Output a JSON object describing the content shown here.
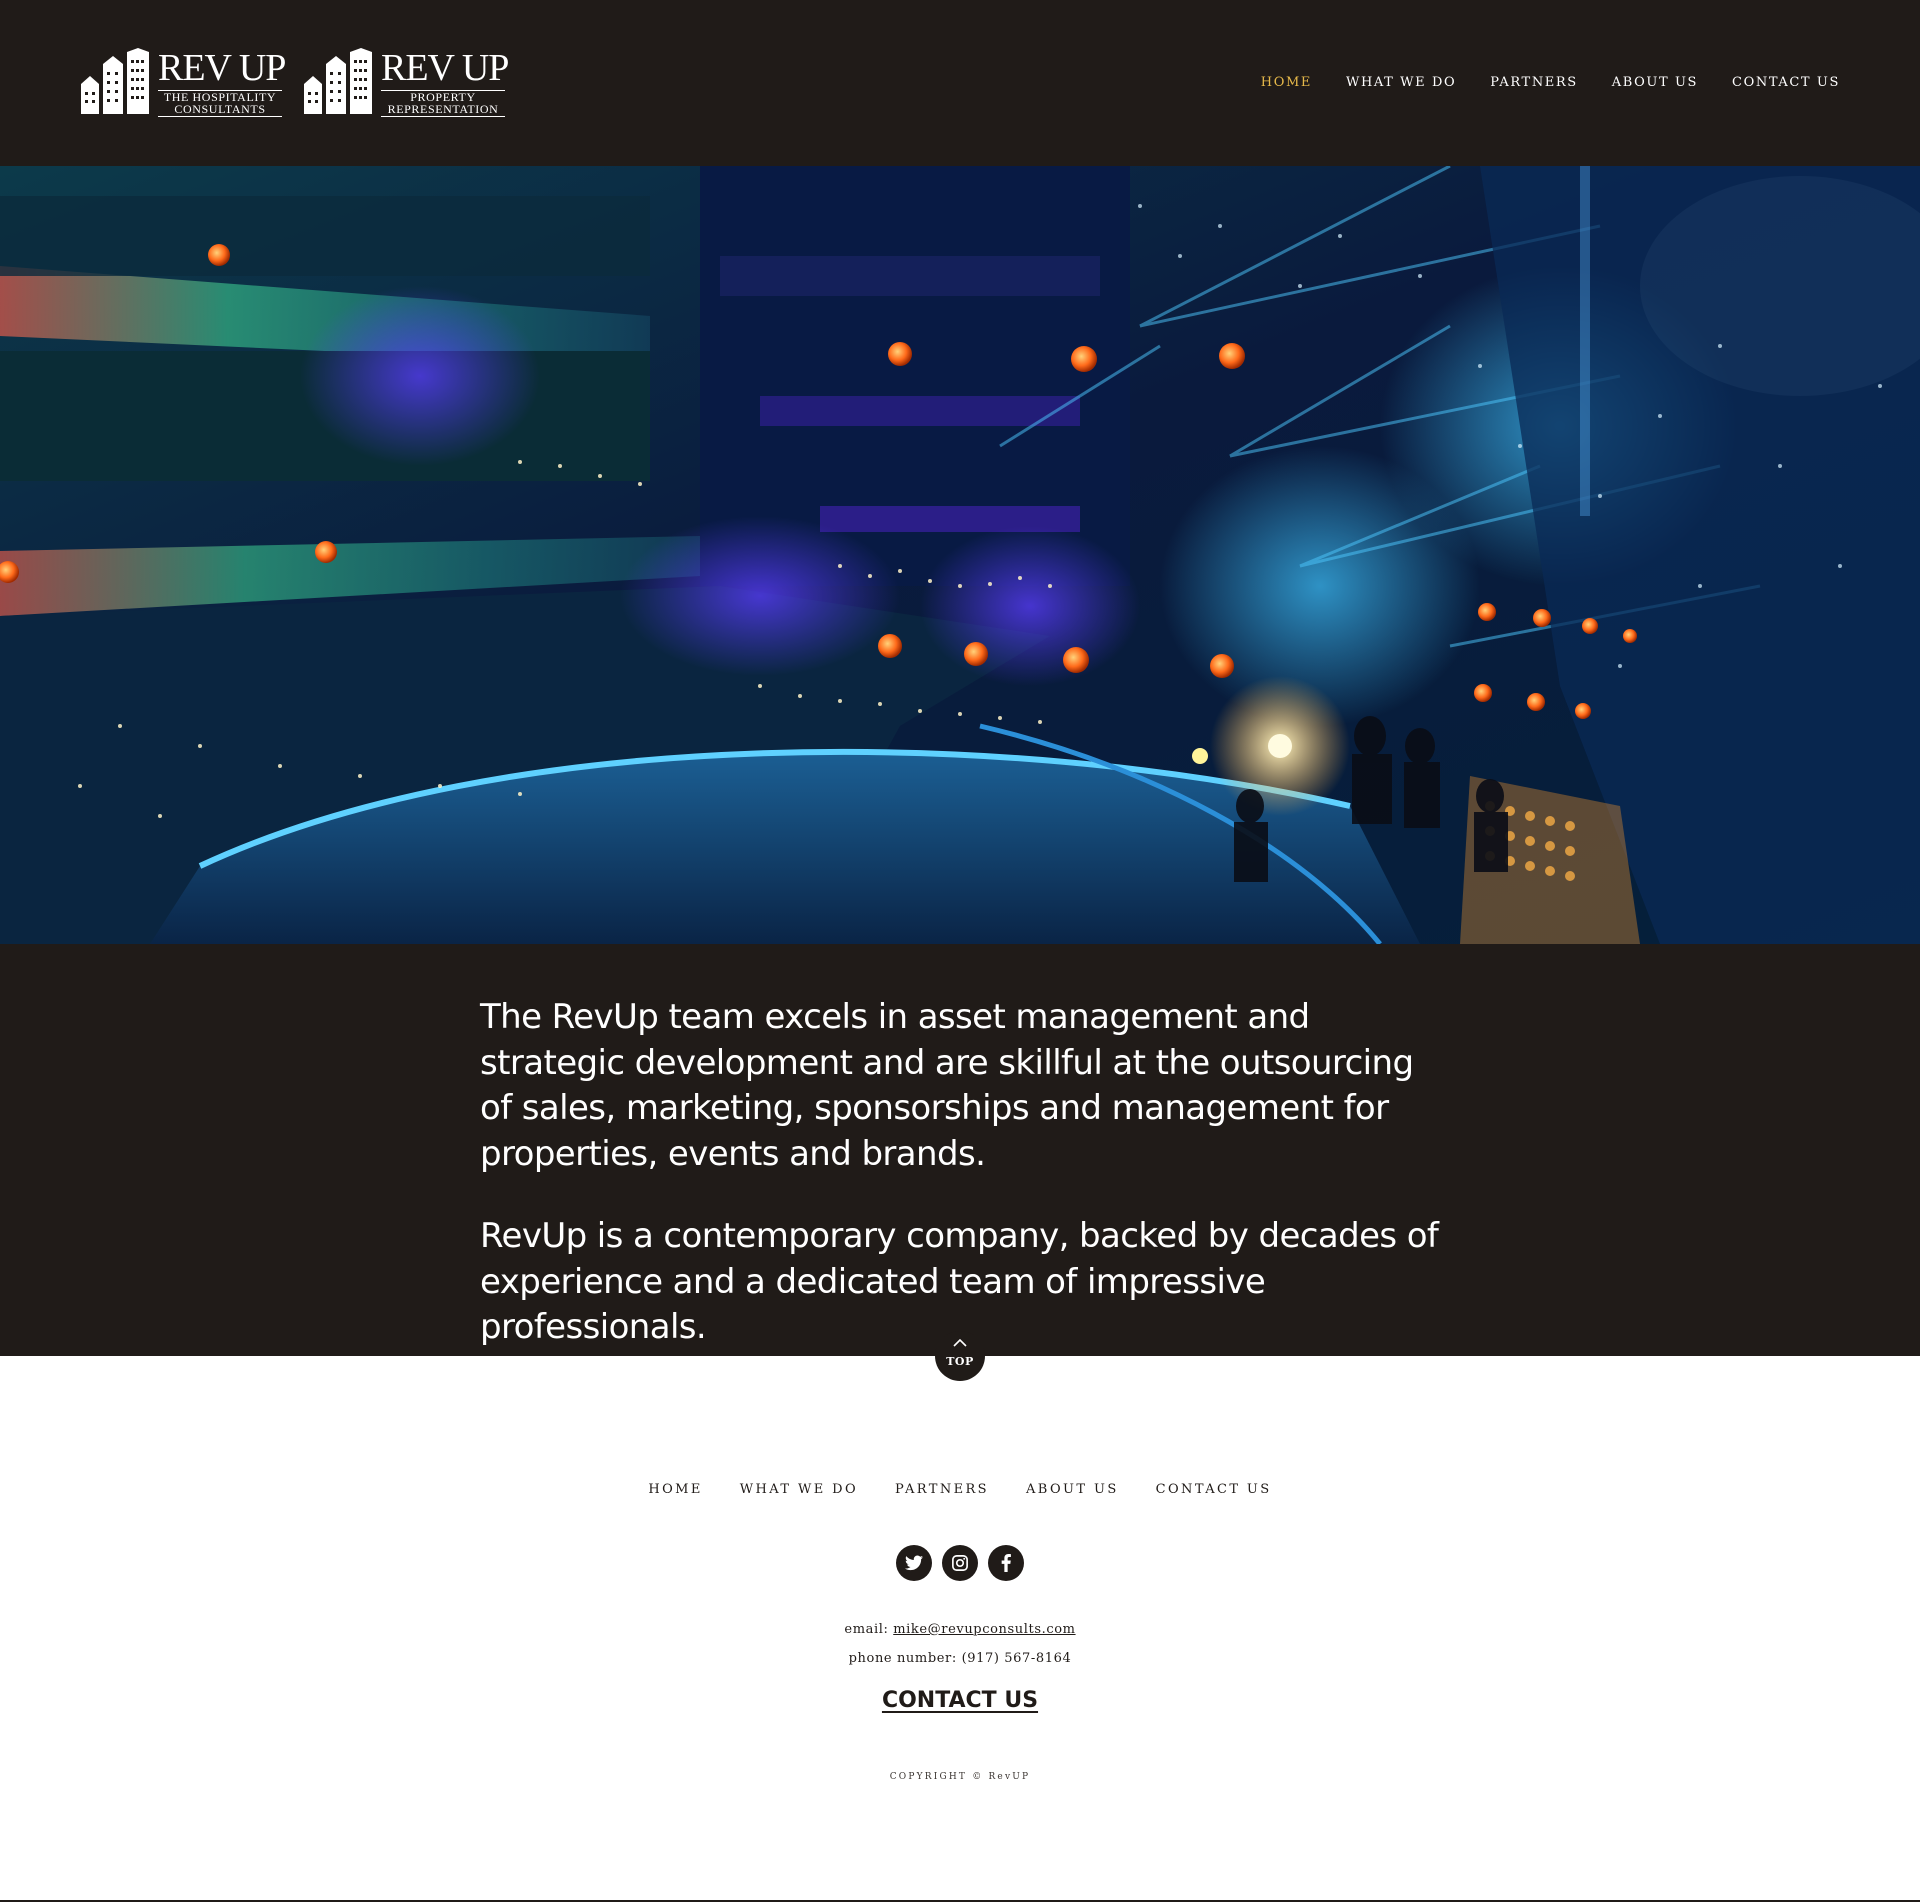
{
  "colors": {
    "header_background": "#201b18",
    "accent": "#e6b94a",
    "footer_background": "#ffffff",
    "text_light": "#ffffff",
    "text_dark": "#201b18"
  },
  "header": {
    "logos": [
      {
        "name": "REV UP",
        "subtitle_line1": "THE HOSPITALITY",
        "subtitle_line2": "CONSULTANTS",
        "icon": "buildings-icon"
      },
      {
        "name": "REV UP",
        "subtitle_line1": "PROPERTY",
        "subtitle_line2": "REPRESENTATION",
        "icon": "buildings-icon"
      }
    ],
    "nav": [
      {
        "label": "HOME",
        "active": true
      },
      {
        "label": "WHAT WE DO",
        "active": false
      },
      {
        "label": "PARTNERS",
        "active": false
      },
      {
        "label": "ABOUT US",
        "active": false
      },
      {
        "label": "CONTACT US",
        "active": false
      }
    ]
  },
  "hero": {
    "image": "concert-arena-photo"
  },
  "intro": {
    "paragraphs": [
      "The RevUp team excels in asset management and strategic development and are skillful at the outsourcing of sales, marketing, sponsorships and management for properties, events and brands.",
      "RevUp is a contemporary company, backed by decades of experience and a dedicated team of impressive professionals."
    ]
  },
  "top_button": {
    "label": "TOP",
    "icon": "chevron-up-icon"
  },
  "footer": {
    "nav": [
      {
        "label": "HOME"
      },
      {
        "label": "WHAT WE DO"
      },
      {
        "label": "PARTNERS"
      },
      {
        "label": "ABOUT US"
      },
      {
        "label": "CONTACT US"
      }
    ],
    "socials": [
      {
        "icon": "twitter-icon"
      },
      {
        "icon": "instagram-icon"
      },
      {
        "icon": "facebook-icon"
      }
    ],
    "email_label": "email:",
    "email_value": "mike@revupconsults.com",
    "phone_label": "phone number:",
    "phone_value": "(917) 567-8164",
    "contact_cta": "CONTACT US",
    "copyright": "COPYRIGHT © RevUP"
  }
}
